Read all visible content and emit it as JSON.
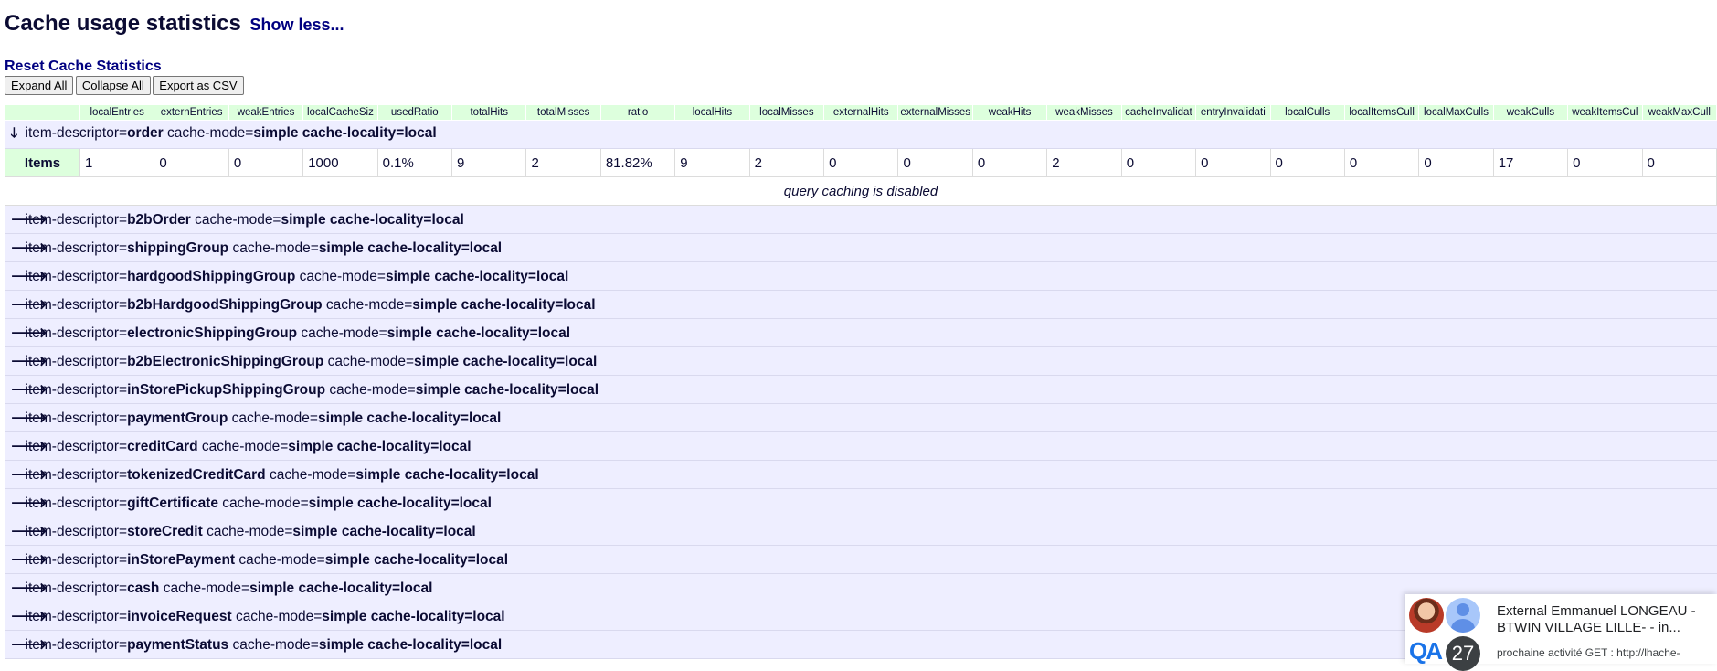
{
  "page": {
    "title": "Cache usage statistics",
    "show_less": "Show less...",
    "reset_link": "Reset Cache Statistics"
  },
  "buttons": {
    "expand_all": "Expand All",
    "collapse_all": "Collapse All",
    "export_csv": "Export as CSV"
  },
  "table": {
    "columns": [
      "",
      "localEntries",
      "externEntries",
      "weakEntries",
      "localCacheSiz",
      "usedRatio",
      "totalHits",
      "totalMisses",
      "ratio",
      "localHits",
      "localMisses",
      "externalHits",
      "externalMisses",
      "weakHits",
      "weakMisses",
      "cacheInvalidat",
      "entryInvalidati",
      "localCulls",
      "localItemsCull",
      "localMaxCulls",
      "weakCulls",
      "weakItemsCul",
      "weakMaxCull"
    ],
    "expanded": {
      "arrow": "🡓",
      "prefix": "item-descriptor=",
      "name": "order",
      "mode_label": "cache-mode=",
      "mode_value": "simple cache-locality=local"
    },
    "items_row": {
      "label": "Items",
      "values": [
        "1",
        "0",
        "0",
        "1000",
        "0.1%",
        "9",
        "2",
        "81.82%",
        "9",
        "2",
        "0",
        "0",
        "0",
        "2",
        "0",
        "0",
        "0",
        "0",
        "0",
        "17",
        "0",
        "0"
      ]
    },
    "query_caching": "query caching is disabled",
    "collapsed_arrow": "🡒",
    "collapsed_prefix": "item-descriptor=",
    "collapsed_mode_label": "cache-mode=",
    "collapsed_mode_value": "simple cache-locality=local",
    "descriptors": [
      "b2bOrder",
      "shippingGroup",
      "hardgoodShippingGroup",
      "b2bHardgoodShippingGroup",
      "electronicShippingGroup",
      "b2bElectronicShippingGroup",
      "inStorePickupShippingGroup",
      "paymentGroup",
      "creditCard",
      "tokenizedCreditCard",
      "giftCertificate",
      "storeCredit",
      "inStorePayment",
      "cash",
      "invoiceRequest",
      "paymentStatus"
    ]
  },
  "notification": {
    "title": "External Emmanuel LONGEAU - BTWIN VILLAGE LILLE- - in...",
    "body": "prochaine activité GET : http://lhache-",
    "badge_count": "27",
    "logo_text": "QA"
  }
}
